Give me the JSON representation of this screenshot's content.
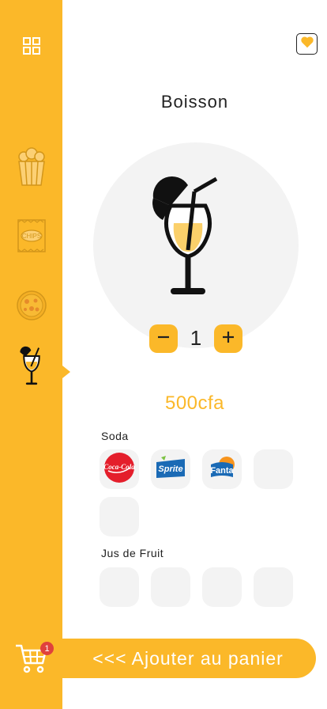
{
  "product": {
    "title": "Boisson",
    "quantity": "1",
    "price": "500cfa"
  },
  "sections": {
    "soda_label": "Soda",
    "juice_label": "Jus de Fruit"
  },
  "soda_items": [
    {
      "name": "Coca-Cola",
      "logo": "Coca-Cola"
    },
    {
      "name": "Sprite",
      "logo": "Sprite"
    },
    {
      "name": "Fanta",
      "logo": "Fanta"
    }
  ],
  "cart": {
    "badge_count": "1",
    "add_button_label": "<<< Ajouter au panier"
  },
  "sidebar_categories": [
    {
      "name": "popcorn",
      "icon": "popcorn-icon",
      "active": false
    },
    {
      "name": "chips",
      "icon": "chips-icon",
      "label": "CHIPS",
      "active": false
    },
    {
      "name": "pizza",
      "icon": "pizza-icon",
      "active": false
    },
    {
      "name": "boisson",
      "icon": "cocktail-icon",
      "active": true
    }
  ],
  "colors": {
    "accent": "#fbb829",
    "badge": "#e0413c",
    "tile": "#f3f3f3"
  }
}
